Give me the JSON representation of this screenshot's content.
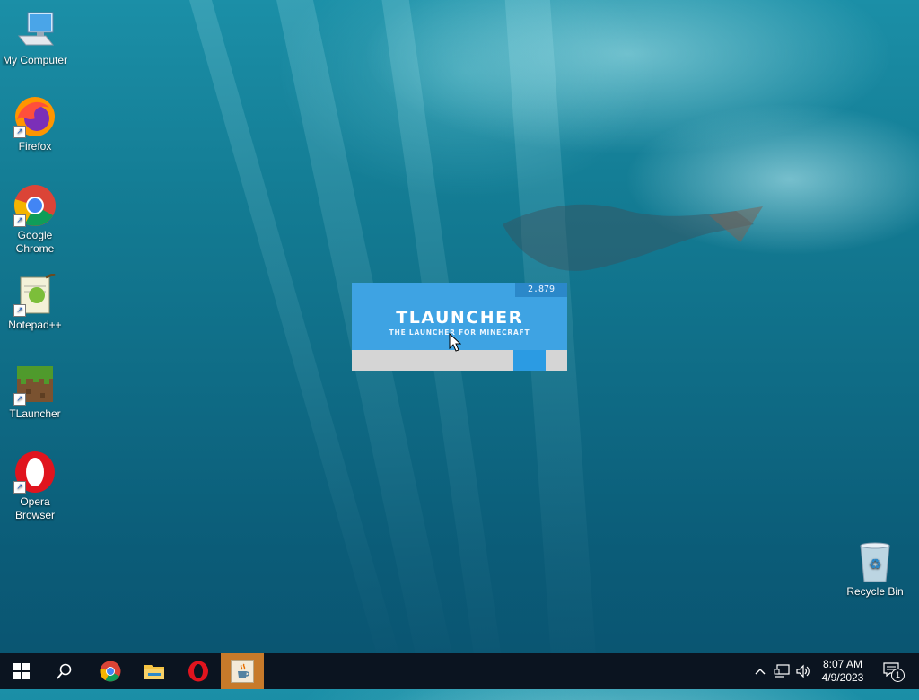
{
  "desktop": {
    "icons": [
      {
        "id": "my-computer",
        "label": "My Computer",
        "icon": "computer-icon"
      },
      {
        "id": "firefox",
        "label": "Firefox",
        "icon": "firefox-icon"
      },
      {
        "id": "google-chrome",
        "label": "Google Chrome",
        "icon": "chrome-icon"
      },
      {
        "id": "notepadpp",
        "label": "Notepad++",
        "icon": "notepadpp-icon"
      },
      {
        "id": "tlauncher",
        "label": "TLauncher",
        "icon": "minecraft-grass-block-icon"
      },
      {
        "id": "opera",
        "label": "Opera Browser",
        "icon": "opera-icon"
      }
    ],
    "recycle_bin": {
      "label": "Recycle Bin",
      "icon": "recycle-bin-icon"
    }
  },
  "splash": {
    "version": "2.879",
    "logo": "TLAUNCHER",
    "tagline": "THE LAUNCHER FOR MINECRAFT",
    "progress_fraction_start": 0.75,
    "progress_fraction_end": 0.9,
    "colors": {
      "header": "#3ea3e3",
      "accent": "#2b9be3",
      "track": "#d5d5d5"
    }
  },
  "taskbar": {
    "buttons": [
      {
        "name": "start-button",
        "icon": "windows-logo-icon"
      },
      {
        "name": "search-button",
        "icon": "search-icon"
      },
      {
        "name": "taskbar-chrome",
        "icon": "chrome-icon"
      },
      {
        "name": "taskbar-file-explorer",
        "icon": "folder-icon"
      },
      {
        "name": "taskbar-opera",
        "icon": "opera-icon"
      },
      {
        "name": "taskbar-java",
        "icon": "java-icon",
        "active": true
      }
    ],
    "tray": {
      "time": "8:07 AM",
      "date": "4/9/2023",
      "notification_count": "1"
    },
    "active_color": "#c77a2a"
  }
}
